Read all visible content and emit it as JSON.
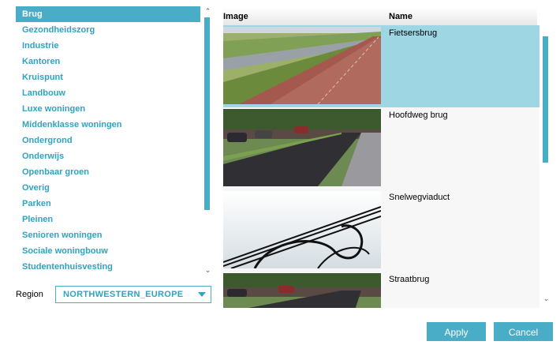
{
  "categories": {
    "items": [
      {
        "label": "Brug",
        "selected": true
      },
      {
        "label": "Gezondheidszorg"
      },
      {
        "label": "Industrie"
      },
      {
        "label": "Kantoren"
      },
      {
        "label": "Kruispunt"
      },
      {
        "label": "Landbouw"
      },
      {
        "label": "Luxe woningen"
      },
      {
        "label": "Middenklasse woningen"
      },
      {
        "label": "Ondergrond"
      },
      {
        "label": "Onderwijs"
      },
      {
        "label": "Openbaar groen"
      },
      {
        "label": "Overig"
      },
      {
        "label": "Parken"
      },
      {
        "label": "Pleinen"
      },
      {
        "label": "Senioren woningen"
      },
      {
        "label": "Sociale woningbouw"
      },
      {
        "label": "Studentenhuisvesting"
      }
    ],
    "scroll_up_icon": "chevron-up-icon",
    "scroll_down_icon": "chevron-down-icon"
  },
  "region": {
    "label": "Region",
    "value": "NORTHWESTERN_EUROPE",
    "icon": "caret-down-icon"
  },
  "table": {
    "headers": {
      "image": "Image",
      "name": "Name"
    },
    "rows": [
      {
        "name": "Fietsersbrug",
        "selected": true,
        "image": "bike-path-photo"
      },
      {
        "name": "Hoofdweg brug",
        "image": "asphalt-road-photo"
      },
      {
        "name": "Snelwegviaduct",
        "image": "highway-interchange-render"
      },
      {
        "name": "Straatbrug",
        "image": "street-bridge-photo"
      }
    ]
  },
  "buttons": {
    "apply": "Apply",
    "cancel": "Cancel"
  },
  "colors": {
    "accent": "#4aadc7",
    "accent_text": "#2fa3c2",
    "selected_row": "#9ed6e4"
  }
}
